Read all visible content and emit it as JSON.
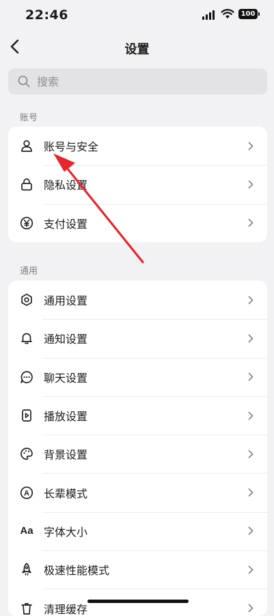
{
  "status_bar": {
    "time": "22:46",
    "battery": "100"
  },
  "nav": {
    "title": "设置"
  },
  "search": {
    "placeholder": "搜索"
  },
  "sections": {
    "account": {
      "label": "账号",
      "items": [
        {
          "label": "账号与安全",
          "icon": "person-icon"
        },
        {
          "label": "隐私设置",
          "icon": "lock-icon"
        },
        {
          "label": "支付设置",
          "icon": "yen-icon"
        }
      ]
    },
    "general": {
      "label": "通用",
      "items": [
        {
          "label": "通用设置",
          "icon": "gear-icon"
        },
        {
          "label": "通知设置",
          "icon": "bell-icon"
        },
        {
          "label": "聊天设置",
          "icon": "chat-icon"
        },
        {
          "label": "播放设置",
          "icon": "play-icon"
        },
        {
          "label": "背景设置",
          "icon": "palette-icon"
        },
        {
          "label": "长辈模式",
          "icon": "elder-mode-icon",
          "icon_text": "A"
        },
        {
          "label": "字体大小",
          "icon": "font-size-icon",
          "icon_text": "Aa"
        },
        {
          "label": "极速性能模式",
          "icon": "rocket-icon"
        },
        {
          "label": "清理缓存",
          "icon": "trash-icon"
        }
      ]
    }
  },
  "annotation": {
    "color": "#e8262d"
  },
  "colors": {
    "background": "#f2f2f4",
    "card": "#ffffff",
    "search_bg": "#e3e3e6"
  }
}
